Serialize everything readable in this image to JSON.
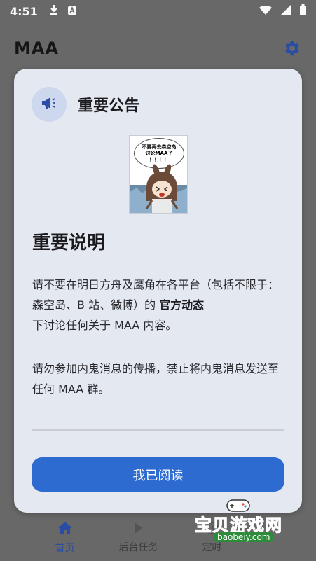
{
  "status_bar": {
    "time": "4:51"
  },
  "app_bar": {
    "title": "MAA"
  },
  "bottom_nav": {
    "items": [
      {
        "label": "首页",
        "icon": "home-icon"
      },
      {
        "label": "后台任务",
        "icon": "play-icon"
      },
      {
        "label": "定时",
        "icon": "clock-icon"
      }
    ]
  },
  "dialog": {
    "title": "重要公告",
    "comic": {
      "line1": "不要再去森空岛",
      "line2": "讨论MAA了",
      "line3": "！！！！"
    },
    "section_title": "重要说明",
    "para1_a": "请不要在明日方舟及鹰角在各平台（包括不限于：森空岛、B 站、微博）的 ",
    "para1_bold": "官方动态",
    "para1_b": "下讨论任何关于 MAA 内容。",
    "para2": "请勿参加内鬼消息的传播，禁止将内鬼消息发送至任何 MAA 群。",
    "read_progress": 0.0,
    "button_label": "我已阅读"
  },
  "watermark": {
    "text": "宝贝游戏网",
    "url": "baobeiy.com"
  },
  "colors": {
    "accent": "#2e6bd1",
    "dialog_bg": "#e4e8f1",
    "icon_blue": "#2a4fa8"
  }
}
